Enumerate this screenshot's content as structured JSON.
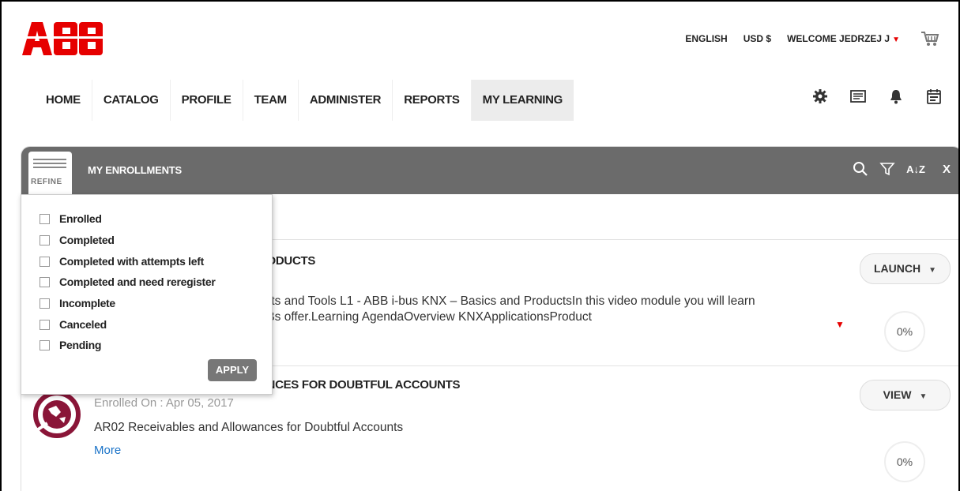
{
  "brand": {
    "logo_text": "ABB",
    "color": "#e60000"
  },
  "header": {
    "language": "ENGLISH",
    "currency": "USD $",
    "welcome": "WELCOME JEDRZEJ J",
    "welcome_caret_icon": "caret-down-icon",
    "cart_icon": "cart-icon"
  },
  "nav": {
    "items": [
      {
        "label": "HOME"
      },
      {
        "label": "CATALOG"
      },
      {
        "label": "PROFILE"
      },
      {
        "label": "TEAM"
      },
      {
        "label": "ADMINISTER"
      },
      {
        "label": "REPORTS"
      },
      {
        "label": "MY LEARNING",
        "active": true
      }
    ],
    "icons": [
      "gear-icon",
      "news-icon",
      "bell-icon",
      "calendar-icon"
    ]
  },
  "panel": {
    "refine_label": "REFINE",
    "title": "MY ENROLLMENTS",
    "close_label": "X",
    "toolbar_icons": [
      "search-icon",
      "filter-icon",
      "sort-az-icon",
      "close-icon"
    ],
    "sort_label": "A↓Z"
  },
  "filter": {
    "options": [
      {
        "label": "Enrolled",
        "checked": false
      },
      {
        "label": "Completed",
        "checked": false
      },
      {
        "label": "Completed with attempts left",
        "checked": false
      },
      {
        "label": "Completed and need reregister",
        "checked": false
      },
      {
        "label": "Incomplete",
        "checked": false
      },
      {
        "label": "Canceled",
        "checked": false
      },
      {
        "label": "Pending",
        "checked": false
      }
    ],
    "apply_label": "APPLY"
  },
  "enrollments": [
    {
      "title_visible": "RODUCTS",
      "desc_line1": "ucts and Tools L1 - ABB i-bus KNX – Basics and ProductsIn this video module you will learn",
      "desc_line2": "BBs offer.Learning AgendaOverview KNXApplicationsProduct",
      "action_label": "LAUNCH",
      "progress": "0%"
    },
    {
      "title_visible": "ANCES FOR DOUBTFUL ACCOUNTS",
      "enrolled_on": "Enrolled On : Apr 05, 2017",
      "desc": "AR02 Receivables and Allowances for Doubtful Accounts",
      "more_label": "More",
      "action_label": "VIEW",
      "progress": "0%"
    }
  ]
}
